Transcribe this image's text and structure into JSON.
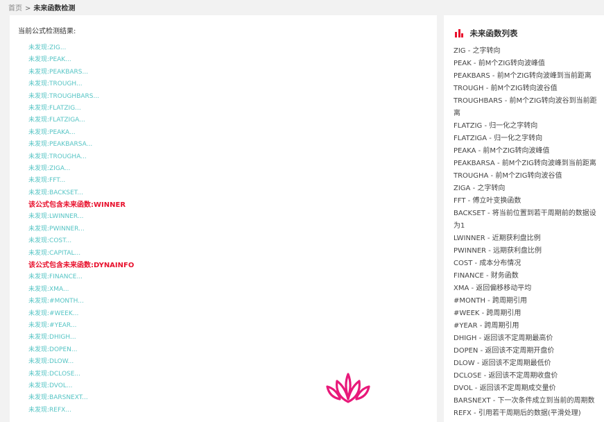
{
  "breadcrumb": {
    "home": "首页",
    "separator": ">",
    "current": "未来函数检测"
  },
  "main": {
    "title": "当前公式检测结果:",
    "results": [
      {
        "text": "未发现:ZIG...",
        "found": false
      },
      {
        "text": "未发现:PEAK...",
        "found": false
      },
      {
        "text": "未发现:PEAKBARS...",
        "found": false
      },
      {
        "text": "未发现:TROUGH...",
        "found": false
      },
      {
        "text": "未发现:TROUGHBARS...",
        "found": false
      },
      {
        "text": "未发现:FLATZIG...",
        "found": false
      },
      {
        "text": "未发现:FLATZIGA...",
        "found": false
      },
      {
        "text": "未发现:PEAKA...",
        "found": false
      },
      {
        "text": "未发现:PEAKBARSA...",
        "found": false
      },
      {
        "text": "未发现:TROUGHA...",
        "found": false
      },
      {
        "text": "未发现:ZIGA...",
        "found": false
      },
      {
        "text": "未发现:FFT...",
        "found": false
      },
      {
        "text": "未发现:BACKSET...",
        "found": false
      },
      {
        "text": "该公式包含未来函数:WINNER",
        "found": true
      },
      {
        "text": "未发现:LWINNER...",
        "found": false
      },
      {
        "text": "未发现:PWINNER...",
        "found": false
      },
      {
        "text": "未发现:COST...",
        "found": false
      },
      {
        "text": "未发现:CAPITAL...",
        "found": false
      },
      {
        "text": "该公式包含未来函数:DYNAINFO",
        "found": true
      },
      {
        "text": "未发现:FINANCE...",
        "found": false
      },
      {
        "text": "未发现:XMA...",
        "found": false
      },
      {
        "text": "未发现:#MONTH...",
        "found": false
      },
      {
        "text": "未发现:#WEEK...",
        "found": false
      },
      {
        "text": "未发现:#YEAR...",
        "found": false
      },
      {
        "text": "未发现:DHIGH...",
        "found": false
      },
      {
        "text": "未发现:DOPEN...",
        "found": false
      },
      {
        "text": "未发现:DLOW...",
        "found": false
      },
      {
        "text": "未发现:DCLOSE...",
        "found": false
      },
      {
        "text": "未发现:DVOL...",
        "found": false
      },
      {
        "text": "未发现:BARSNEXT...",
        "found": false
      },
      {
        "text": "未发现:REFX...",
        "found": false
      }
    ]
  },
  "sidebar": {
    "title": "未来函数列表",
    "items": [
      "ZIG - 之字转向",
      "PEAK - 前M个ZIG转向波峰值",
      "PEAKBARS - 前M个ZIG转向波峰到当前距离",
      "TROUGH - 前M个ZIG转向波谷值",
      "TROUGHBARS - 前M个ZIG转向波谷到当前距离",
      "FLATZIG - 归一化之字转向",
      "FLATZIGA - 归一化之字转向",
      "PEAKA - 前M个ZIG转向波峰值",
      "PEAKBARSA - 前M个ZIG转向波峰到当前距离",
      "TROUGHA - 前M个ZIG转向波谷值",
      "ZIGA - 之字转向",
      "FFT - 傅立叶变换函数",
      "BACKSET - 将当前位置到若干周期前的数据设为1",
      "LWINNER - 近期获利盘比例",
      "PWINNER - 远期获利盘比例",
      "COST - 成本分布情况",
      "FINANCE - 财务函数",
      "XMA - 返回偏移移动平均",
      "#MONTH - 跨周期引用",
      "#WEEK - 跨周期引用",
      "#YEAR - 跨周期引用",
      "DHIGH - 返回该不定周期最高价",
      "DOPEN - 返回该不定周期开盘价",
      "DLOW - 返回该不定周期最低价",
      "DCLOSE - 返回该不定周期收盘价",
      "DVOL - 返回该不定周期成交量价",
      "BARSNEXT - 下一次条件成立到当前的周期数",
      "REFX - 引用若干周期后的数据(平滑处理)"
    ]
  },
  "colors": {
    "not_found": "#55c4c4",
    "found": "#e8112d",
    "accent": "#e8112d",
    "watermark": "#e8197a"
  },
  "icons": {
    "title_icon": "bar-chart-icon",
    "watermark": "lotus-logo"
  }
}
